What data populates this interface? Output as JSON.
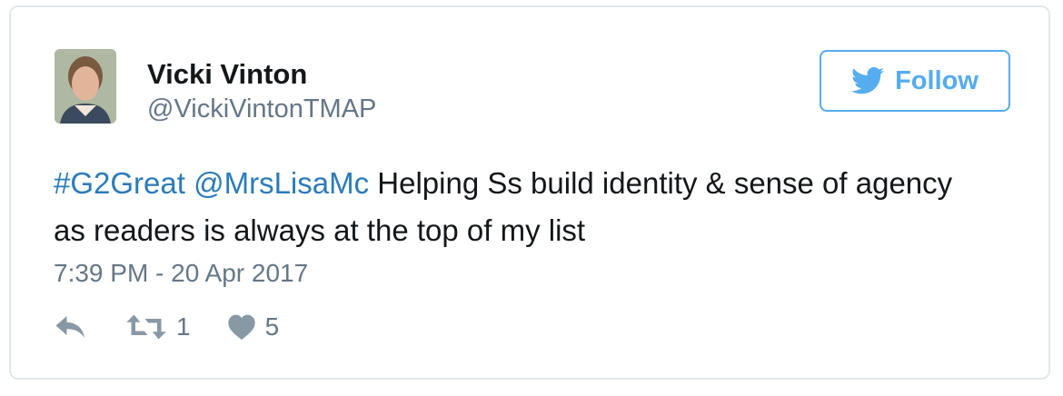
{
  "tweet": {
    "author_name": "Vicki Vinton",
    "author_handle": "@VickiVintonTMAP",
    "follow_label": "Follow",
    "hashtag": "#G2Great",
    "mention": "@MrsLisaMc",
    "body_text": " Helping Ss build identity & sense of agency as readers is always at the top of my list",
    "timestamp": "7:39 PM - 20 Apr 2017",
    "retweet_count": "1",
    "like_count": "5"
  },
  "icons": {
    "follow": "twitter-bird-icon",
    "reply": "reply-icon",
    "retweet": "retweet-icon",
    "like": "heart-icon"
  },
  "colors": {
    "accent": "#55acee",
    "link": "#2b7bb9",
    "text": "#14171a",
    "muted": "#657786",
    "border": "#e1e8ed"
  }
}
